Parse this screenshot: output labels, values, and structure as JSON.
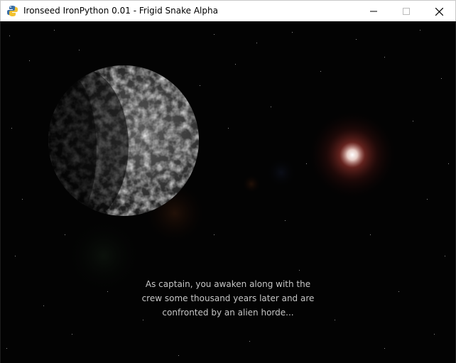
{
  "window": {
    "title": "Ironseed IronPython 0.01 - Frigid Snake Alpha",
    "icon": "python-snake-icon",
    "controls": [
      "minimize-icon",
      "maximize-icon",
      "close-icon"
    ]
  },
  "scene": {
    "background_color": "#030303",
    "planet_color": "#8a8a8a",
    "sun_color": "#ffe8e0",
    "sun_glow_color": "#b02020",
    "story_lines": [
      "As captain, you awaken along with the",
      "crew some thousand years later and are",
      "confronted by an alien horde..."
    ]
  }
}
